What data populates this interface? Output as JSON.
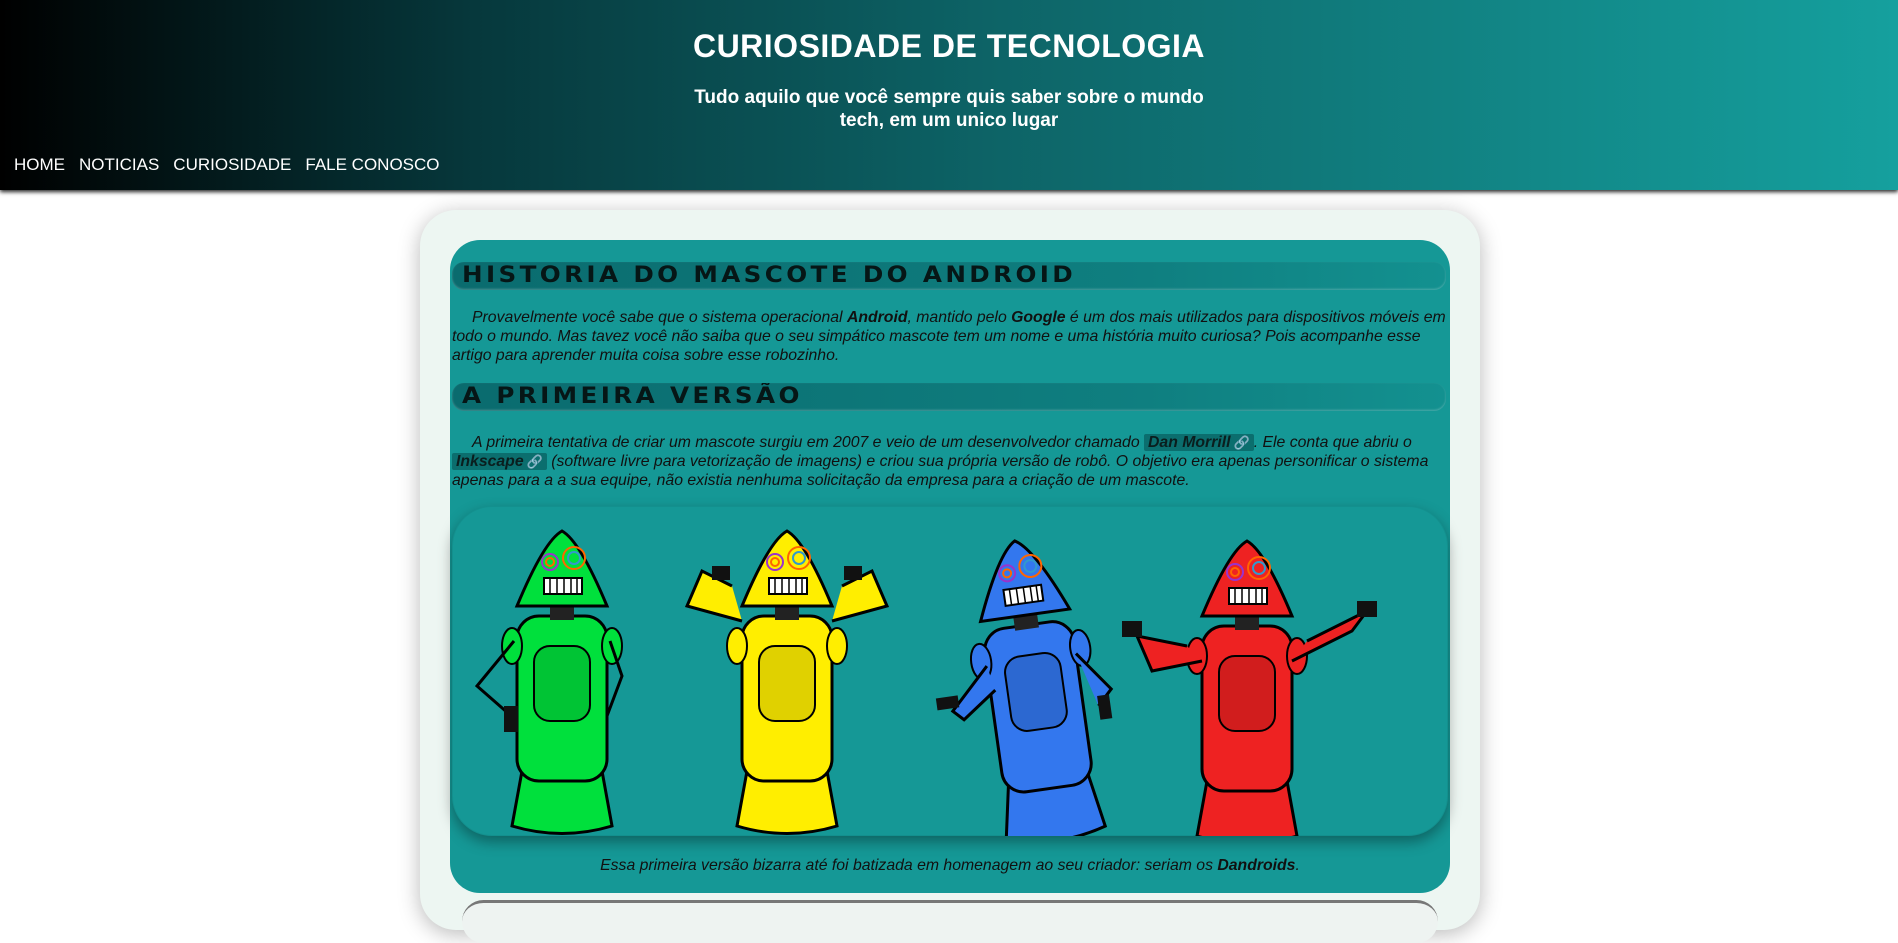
{
  "header": {
    "title": "CURIOSIDADE DE TECNOLOGIA",
    "subtitle": "Tudo aquilo que você sempre quis saber sobre o mundo tech, em um unico lugar"
  },
  "nav": {
    "items": [
      {
        "label": "HOME"
      },
      {
        "label": "NOTICIAS"
      },
      {
        "label": "CURIOSIDADE"
      },
      {
        "label": "FALE CONOSCO"
      }
    ]
  },
  "article": {
    "heading1": "Historia do mascote do Android",
    "intro": {
      "t1": "Provavelmente você sabe que o sistema operacional ",
      "b1": "Android",
      "t2": ", mantido pelo ",
      "b2": "Google",
      "t3": " é um dos mais utilizados para dispositivos móveis em todo o mundo. Mas tavez você não saiba que o seu simpático mascote tem um nome e uma história muito curiosa? Pois acompanhe esse artigo para aprender muita coisa sobre esse robozinho."
    },
    "heading2": "A primeira versão",
    "para2": {
      "t1": "A primeira tentativa de criar um mascote surgiu em 2007 e veio de um desenvolvedor chamado ",
      "link1": "Dan Morrill",
      "t2": ". Ele conta que abriu o ",
      "link2": "Inkscape",
      "t3": " (software livre para vetorização de imagens) e criou sua própria versão de robô. O objetivo era apenas personificar o sistema apenas para a a sua equipe, não existia nenhuma solicitação da empresa para a criação de um mascote."
    },
    "caption": {
      "t1": "Essa primeira versão bizarra até foi batizada em homenagem ao seu criador: seriam os ",
      "b1": "Dandroids",
      "t2": "."
    }
  },
  "colors": {
    "header_start": "#000000",
    "header_end": "#15a09e",
    "article_bg": "#159896",
    "container_bg": "#edf6f2",
    "robots": [
      "#00e03c",
      "#ffee00",
      "#3377ee",
      "#ee2222"
    ]
  },
  "icons": [
    "link-icon"
  ]
}
